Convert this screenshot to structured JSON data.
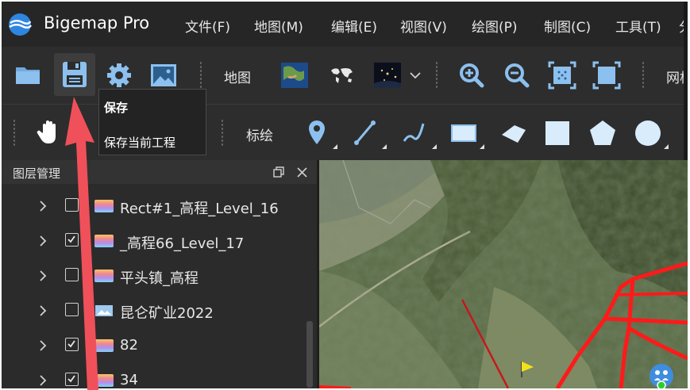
{
  "app": {
    "title": "Bigemap Pro"
  },
  "menu": [
    {
      "label": "文件(F)"
    },
    {
      "label": "地图(M)"
    },
    {
      "label": "编辑(E)"
    },
    {
      "label": "视图(V)"
    },
    {
      "label": "绘图(P)"
    },
    {
      "label": "制图(C)"
    },
    {
      "label": "工具(T)"
    },
    {
      "label": "分"
    }
  ],
  "toolbar1": {
    "map_label": "地图",
    "grid_label": "网格"
  },
  "toolbar2": {
    "annotate_label": "标绘"
  },
  "tooltip": {
    "title": "保存",
    "description": "保存当前工程"
  },
  "layer_panel": {
    "title": "图层管理",
    "layers": [
      {
        "name": "Rect#1_高程_Level_16",
        "checked": false,
        "icon": "elevation-gradient-icon"
      },
      {
        "name": "_高程66_Level_17",
        "checked": true,
        "icon": "elevation-gradient-icon"
      },
      {
        "name": "平头镇_高程",
        "checked": false,
        "icon": "elevation-gradient-icon"
      },
      {
        "name": "昆仑矿业2022",
        "checked": false,
        "icon": "image-layer-icon"
      },
      {
        "name": "82",
        "checked": true,
        "icon": "elevation-gradient-icon"
      },
      {
        "name": "34",
        "checked": true,
        "icon": "elevation-gradient-icon"
      }
    ]
  },
  "colors": {
    "background": "#2b2b2b",
    "titlebar": "#262626",
    "accent_blue": "#3a8ee6",
    "annotation_red": "#f0505a",
    "route_red": "#ff1a1a"
  }
}
